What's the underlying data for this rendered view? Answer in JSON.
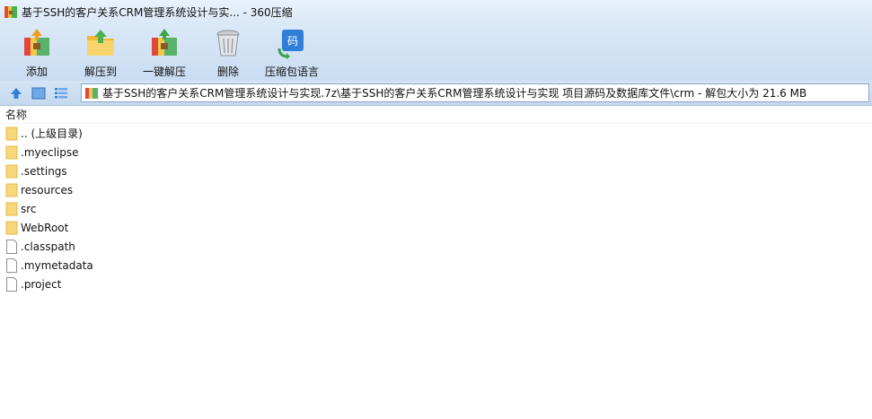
{
  "window": {
    "title": "基于SSH的客户关系CRM管理系统设计与实... - 360压缩",
    "icon": "archive-app-icon"
  },
  "toolbar": {
    "items": [
      {
        "label": "添加",
        "icon": "add-archive-icon"
      },
      {
        "label": "解压到",
        "icon": "extract-to-icon"
      },
      {
        "label": "一键解压",
        "icon": "one-click-extract-icon"
      },
      {
        "label": "删除",
        "icon": "delete-bin-icon"
      },
      {
        "label": "压缩包语言",
        "icon": "archive-language-icon"
      }
    ]
  },
  "navbar": {
    "path": "基于SSH的客户关系CRM管理系统设计与实现.7z\\基于SSH的客户关系CRM管理系统设计与实现 项目源码及数据库文件\\crm - 解包大小为 21.6 MB"
  },
  "list": {
    "column_name": "名称",
    "items": [
      {
        "name": ".. (上级目录)",
        "type": "folder"
      },
      {
        "name": ".myeclipse",
        "type": "folder"
      },
      {
        "name": ".settings",
        "type": "folder"
      },
      {
        "name": "resources",
        "type": "folder"
      },
      {
        "name": "src",
        "type": "folder"
      },
      {
        "name": "WebRoot",
        "type": "folder"
      },
      {
        "name": ".classpath",
        "type": "file"
      },
      {
        "name": ".mymetadata",
        "type": "file"
      },
      {
        "name": ".project",
        "type": "file"
      }
    ]
  },
  "colors": {
    "toolbar_bg": "#c9dcf2",
    "folder": "#f7d77a",
    "accent": "#2f7fd8"
  }
}
